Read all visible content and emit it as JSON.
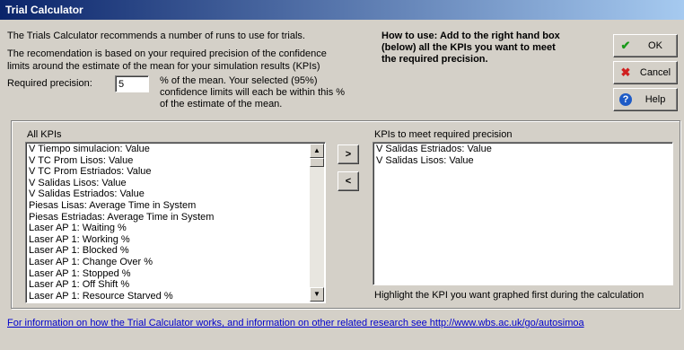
{
  "window": {
    "title": "Trial Calculator"
  },
  "intro": {
    "line1": "The Trials Calculator recommends a number of runs to use for trials.",
    "line2": "The recomendation is based on your required precision of the confidence",
    "line3": "limits around the estimate of the mean for your simulation results (KPIs)"
  },
  "precision": {
    "label": "Required precision:",
    "value": "5",
    "desc1": "% of the mean.  Your selected (95%)",
    "desc2": "confidence limits will each be within this %",
    "desc3": "of the estimate of the mean."
  },
  "howto": {
    "line1": "How to use: Add to the right hand box",
    "line2": "(below) all the KPIs you want to meet",
    "line3": "the required precision."
  },
  "buttons": {
    "ok": "OK",
    "cancel": "Cancel",
    "help": "Help",
    "add": ">",
    "remove": "<"
  },
  "icons": {
    "ok": "check-icon",
    "cancel": "cross-icon",
    "help": "question-icon",
    "scroll_up": "up-arrow-icon",
    "scroll_down": "down-arrow-icon"
  },
  "all_kpis": {
    "label": "All KPIs",
    "items": [
      "V Tiempo simulacion: Value",
      "V TC Prom Lisos: Value",
      "V TC Prom Estriados: Value",
      "V Salidas Lisos: Value",
      "V Salidas Estriados: Value",
      "Piesas Lisas: Average Time in System",
      "Piesas Estriadas: Average Time in System",
      "Laser AP 1: Waiting %",
      "Laser AP 1: Working %",
      "Laser AP 1: Blocked %",
      "Laser AP 1: Change Over %",
      "Laser AP 1: Stopped %",
      "Laser AP 1: Off Shift %",
      "Laser AP 1: Resource Starved %"
    ]
  },
  "selected_kpis": {
    "label": "KPIs to meet required precision",
    "items": [
      "V Salidas Estriados: Value",
      "V Salidas Lisos: Value"
    ],
    "hint": "Highlight the KPI you want graphed first during the calculation"
  },
  "footer": {
    "link": "For information on how the Trial Calculator works, and information on other related research see http://www.wbs.ac.uk/go/autosimoa"
  }
}
